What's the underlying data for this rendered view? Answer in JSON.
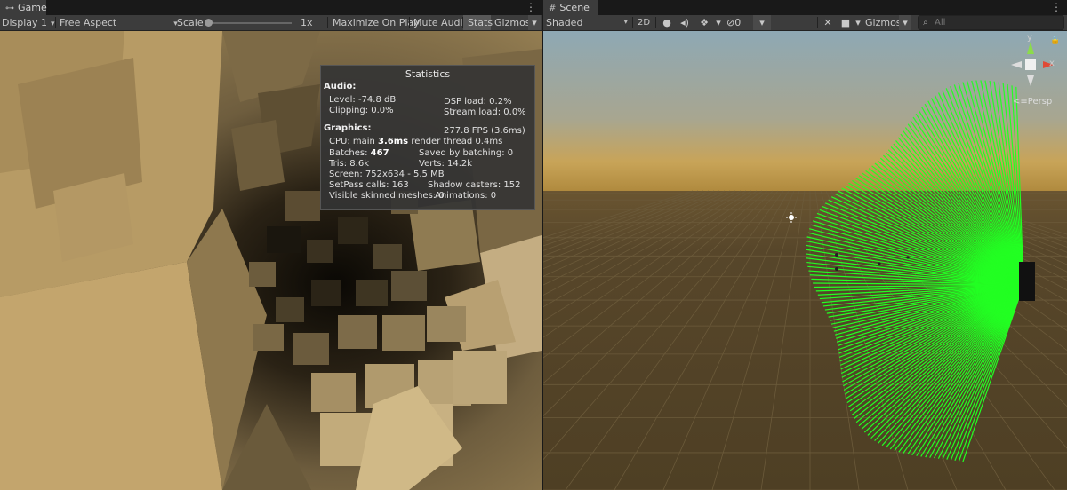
{
  "game": {
    "tab_label": "Game",
    "tab_icon": "gamepad-icon",
    "toolbar": {
      "display": "Display 1",
      "aspect": "Free Aspect",
      "scale_label": "Scale",
      "scale_value": "1x",
      "scale_slider_level": 0,
      "maximize_on_play": "Maximize On Play",
      "mute_audio": "Mute Audio",
      "stats": "Stats",
      "gizmos": "Gizmos"
    },
    "stats": {
      "title": "Statistics",
      "audio_heading": "Audio:",
      "level": "Level: -74.8 dB",
      "dsp_load": "DSP load: 0.2%",
      "clipping": "Clipping: 0.0%",
      "stream_load": "Stream load: 0.0%",
      "graphics_heading": "Graphics:",
      "fps": "277.8 FPS (3.6ms)",
      "cpu_prefix": "CPU: main ",
      "cpu_main": "3.6ms",
      "cpu_suffix": " render thread 0.4ms",
      "batches_prefix": "Batches: ",
      "batches": "467",
      "saved_by_batching": "Saved by batching: 0",
      "tris": "Tris: 8.6k",
      "verts": "Verts: 14.2k",
      "screen": "Screen: 752x634 - 5.5 MB",
      "setpass": "SetPass calls: 163",
      "shadow_casters": "Shadow casters: 152",
      "skinned": "Visible skinned meshes: 0",
      "animations": "Animations: 0"
    }
  },
  "scene": {
    "tab_label": "Scene",
    "tab_icon": "grid-icon",
    "toolbar": {
      "shading": "Shaded",
      "mode_2d": "2D",
      "hidden_count": "0",
      "gizmos": "Gizmos",
      "search_placeholder": "All"
    },
    "gizmo": {
      "y_axis": "y",
      "x_axis": "x",
      "projection": "Persp"
    }
  },
  "colors": {
    "panel_bg": "#282828",
    "toolbar_bg": "#3c3c3c",
    "ray_green": "#22ff22",
    "sky_top": "#8ea8b4",
    "ground": "#4e3f24"
  }
}
